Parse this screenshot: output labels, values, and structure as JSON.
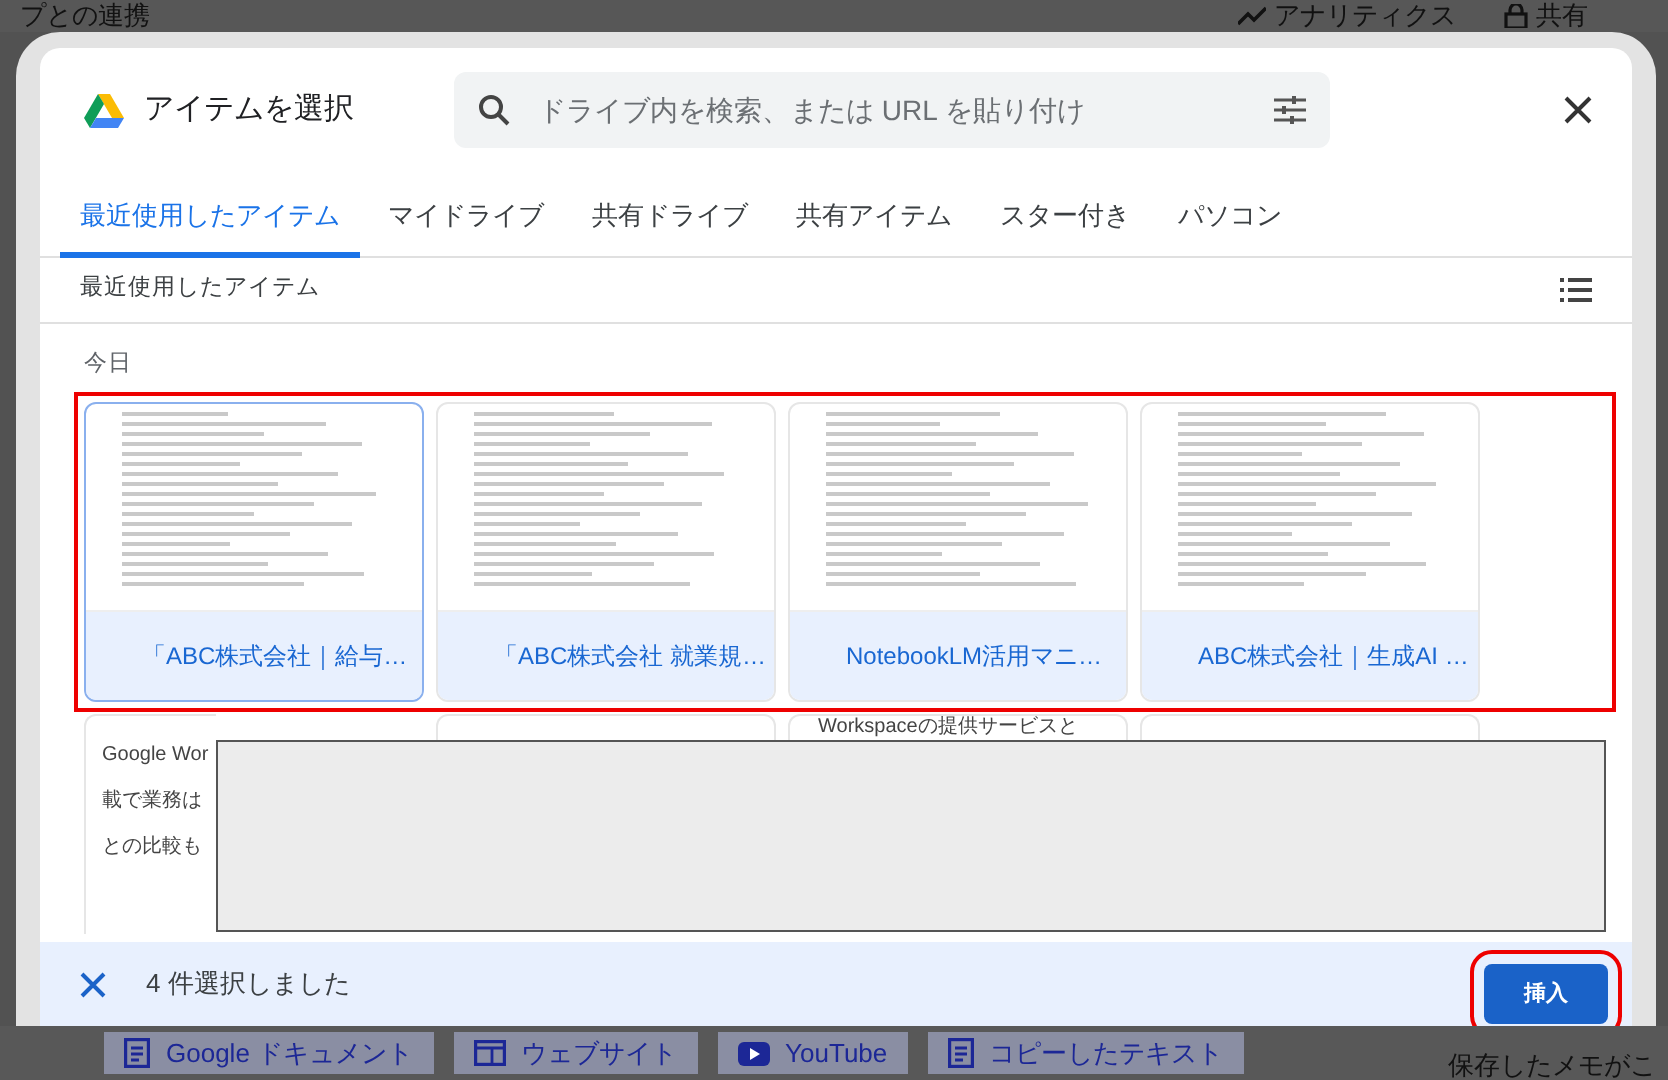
{
  "background": {
    "title": "プとの連携",
    "actions": [
      {
        "kind": "analytics",
        "label": "アナリティクス"
      },
      {
        "kind": "share",
        "label": "共有"
      }
    ],
    "chips": [
      {
        "kind": "doc",
        "label": "Google ドキュメント"
      },
      {
        "kind": "website",
        "label": "ウェブサイト"
      },
      {
        "kind": "youtube",
        "label": "YouTube"
      },
      {
        "kind": "doc",
        "label": "コピーしたテキスト"
      }
    ],
    "note": "保存したメモがこ"
  },
  "dialog": {
    "title": "アイテムを選択",
    "search": {
      "placeholder": "ドライブ内を検索、または URL を貼り付け"
    },
    "tabs": [
      {
        "label": "最近使用したアイテム",
        "selected": true
      },
      {
        "label": "マイドライブ",
        "selected": false
      },
      {
        "label": "共有ドライブ",
        "selected": false
      },
      {
        "label": "共有アイテム",
        "selected": false
      },
      {
        "label": "スター付き",
        "selected": false
      },
      {
        "label": "パソコン",
        "selected": false
      }
    ],
    "section_title": "最近使用したアイテム",
    "group_label": "今日",
    "files": [
      {
        "name": "「ABC株式会社｜給与…",
        "selected": true,
        "focused": true
      },
      {
        "name": "「ABC株式会社 就業規…",
        "selected": true,
        "focused": false
      },
      {
        "name": "NotebookLM活用マニ…",
        "selected": true,
        "focused": false
      },
      {
        "name": "ABC株式会社｜生成AI …",
        "selected": true,
        "focused": false
      }
    ],
    "more_files": {
      "preview_lines": [
        "Google Wor",
        "載で業務は",
        "との比較も"
      ],
      "next_titles": [
        {
          "kind": "blank"
        },
        {
          "kind": "titled",
          "title": "Workspaceの提供サービスと"
        },
        {
          "kind": "blank"
        }
      ]
    },
    "selection_text": "4 件選択しました",
    "insert_button": "挿入"
  }
}
